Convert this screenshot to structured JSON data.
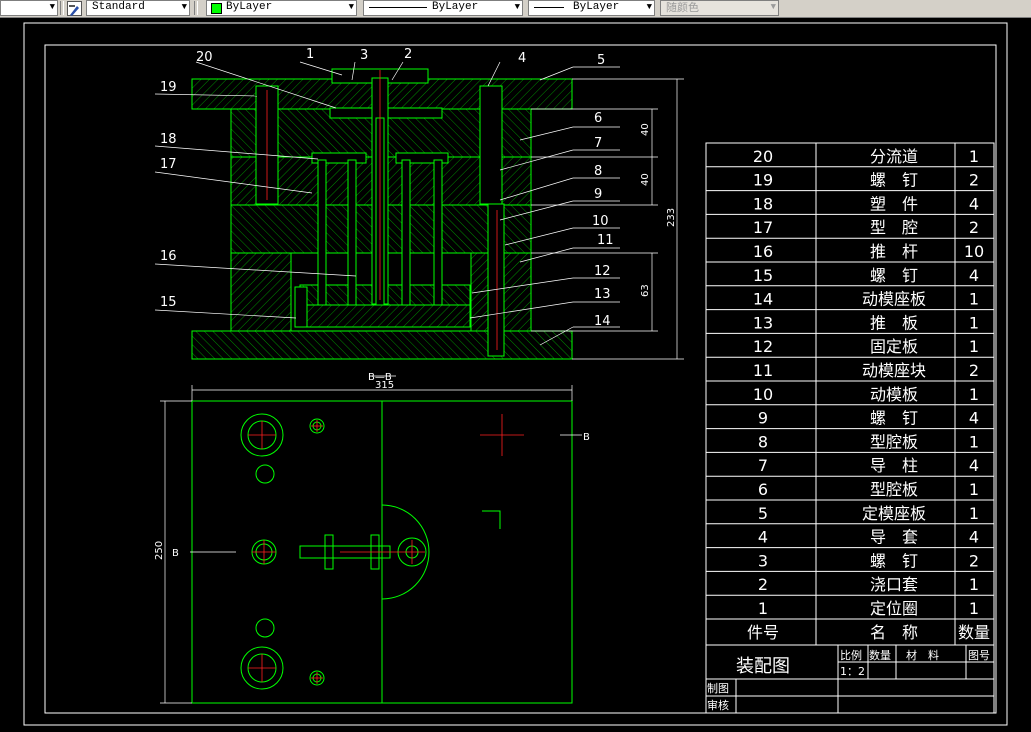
{
  "toolbar": {
    "text_style": "Standard",
    "layer": "ByLayer",
    "linetype": "ByLayer",
    "lineweight": "ByLayer",
    "plot_style": "随颜色",
    "layer_color": "#00ff00"
  },
  "drawing": {
    "leaders": [
      "1",
      "2",
      "3",
      "4",
      "5",
      "6",
      "7",
      "8",
      "9",
      "10",
      "11",
      "12",
      "13",
      "14",
      "15",
      "16",
      "17",
      "18",
      "19",
      "20"
    ],
    "dims": {
      "d40a": "40",
      "d40b": "40",
      "d63": "63",
      "d233": "233",
      "d315": "315",
      "d250": "250"
    },
    "section_title": "B—B",
    "section_mark": "B"
  },
  "bom": {
    "rows": [
      {
        "no": "20",
        "name": "分流道",
        "qty": "1"
      },
      {
        "no": "19",
        "name": "螺　钉",
        "qty": "2"
      },
      {
        "no": "18",
        "name": "塑　件",
        "qty": "4"
      },
      {
        "no": "17",
        "name": "型　腔",
        "qty": "2"
      },
      {
        "no": "16",
        "name": "推　杆",
        "qty": "10"
      },
      {
        "no": "15",
        "name": "螺　钉",
        "qty": "4"
      },
      {
        "no": "14",
        "name": "动模座板",
        "qty": "1"
      },
      {
        "no": "13",
        "name": "推　板",
        "qty": "1"
      },
      {
        "no": "12",
        "name": "固定板",
        "qty": "1"
      },
      {
        "no": "11",
        "name": "动模座块",
        "qty": "2"
      },
      {
        "no": "10",
        "name": "动模板",
        "qty": "1"
      },
      {
        "no": "9",
        "name": "螺　钉",
        "qty": "4"
      },
      {
        "no": "8",
        "name": "型腔板",
        "qty": "1"
      },
      {
        "no": "7",
        "name": "导　柱",
        "qty": "4"
      },
      {
        "no": "6",
        "name": "型腔板",
        "qty": "1"
      },
      {
        "no": "5",
        "name": "定模座板",
        "qty": "1"
      },
      {
        "no": "4",
        "name": "导　套",
        "qty": "4"
      },
      {
        "no": "3",
        "name": "螺　钉",
        "qty": "2"
      },
      {
        "no": "2",
        "name": "浇口套",
        "qty": "1"
      },
      {
        "no": "1",
        "name": "定位圈",
        "qty": "1"
      }
    ],
    "header": {
      "no": "件号",
      "name": "名　称",
      "qty": "数量"
    },
    "title_block": {
      "title": "装配图",
      "scale_label": "比例",
      "qty_label": "数量",
      "material_label": "材　料",
      "drawing_no_label": "图号",
      "scale_value": "1：2",
      "drawn_label": "制图",
      "check_label": "审核"
    }
  }
}
